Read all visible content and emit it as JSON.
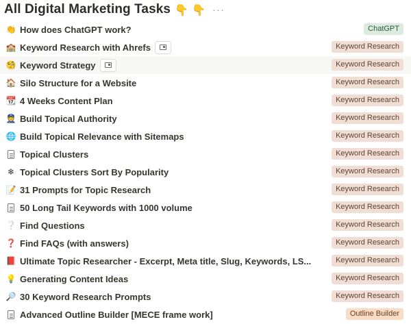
{
  "header": {
    "title": "All Digital Marketing Tasks",
    "emoji": "👇 👇",
    "more": "···"
  },
  "colors": {
    "keyword_research_tag_bg": "#f0ded4",
    "chatgpt_tag_bg": "#dcebdf",
    "outline_builder_tag_bg": "#f8dcc6"
  },
  "rows": [
    {
      "icon": "clap-icon",
      "glyph": "👏",
      "label": "How does ChatGPT work?",
      "tag": "ChatGPT",
      "tag_type": "gpt"
    },
    {
      "icon": "school-icon",
      "glyph": "🏫",
      "label": "Keyword Research with Ahrefs",
      "tag": "Keyword Research",
      "tag_type": "kr",
      "open": true
    },
    {
      "icon": "monocle-face-icon",
      "glyph": "🧐",
      "label": "Keyword Strategy",
      "tag": "Keyword Research",
      "tag_type": "kr",
      "open": true,
      "hover": true
    },
    {
      "icon": "house-icon",
      "glyph": "🏠",
      "label": "Silo Structure for a Website",
      "tag": "Keyword Research",
      "tag_type": "kr"
    },
    {
      "icon": "calendar-icon",
      "glyph": "📆",
      "label": "4 Weeks Content Plan",
      "tag": "Keyword Research",
      "tag_type": "kr"
    },
    {
      "icon": "police-officer-icon",
      "glyph": "👮",
      "label": "Build Topical Authority",
      "tag": "Keyword Research",
      "tag_type": "kr"
    },
    {
      "icon": "globe-icon",
      "glyph": "🌐",
      "label": "Build Topical Relevance with Sitemaps",
      "tag": "Keyword Research",
      "tag_type": "kr"
    },
    {
      "icon": "document-icon",
      "glyph": "",
      "label": "Topical Clusters",
      "tag": "Keyword Research",
      "tag_type": "kr"
    },
    {
      "icon": "snowflake-icon",
      "glyph": "❄",
      "label": "Topical Clusters Sort By Popularity",
      "tag": "Keyword Research",
      "tag_type": "kr"
    },
    {
      "icon": "memo-icon",
      "glyph": "📝",
      "label": "31 Prompts for Topic Research",
      "tag": "Keyword Research",
      "tag_type": "kr"
    },
    {
      "icon": "document-icon",
      "glyph": "",
      "label": "50 Long Tail Keywords with 1000 volume",
      "tag": "Keyword Research",
      "tag_type": "kr"
    },
    {
      "icon": "white-question-icon",
      "glyph": "❔",
      "label": "Find Questions",
      "tag": "Keyword Research",
      "tag_type": "kr"
    },
    {
      "icon": "red-question-icon",
      "glyph": "❓",
      "label": "Find FAQs (with answers)",
      "tag": "Keyword Research",
      "tag_type": "kr"
    },
    {
      "icon": "red-book-icon",
      "glyph": "📕",
      "label": "Ultimate Topic Researcher - Excerpt, Meta title, Slug, Keywords, LS...",
      "tag": "Keyword Research",
      "tag_type": "kr"
    },
    {
      "icon": "lightbulb-icon",
      "glyph": "💡",
      "label": "Generating Content Ideas",
      "tag": "Keyword Research",
      "tag_type": "kr"
    },
    {
      "icon": "magnifier-icon",
      "glyph": "🔎",
      "label": "30 Keyword Research Prompts",
      "tag": "Keyword Research",
      "tag_type": "kr"
    },
    {
      "icon": "document-icon",
      "glyph": "",
      "label": "Advanced Outline Builder [MECE frame work]",
      "tag": "Outline Builder",
      "tag_type": "ob"
    }
  ]
}
